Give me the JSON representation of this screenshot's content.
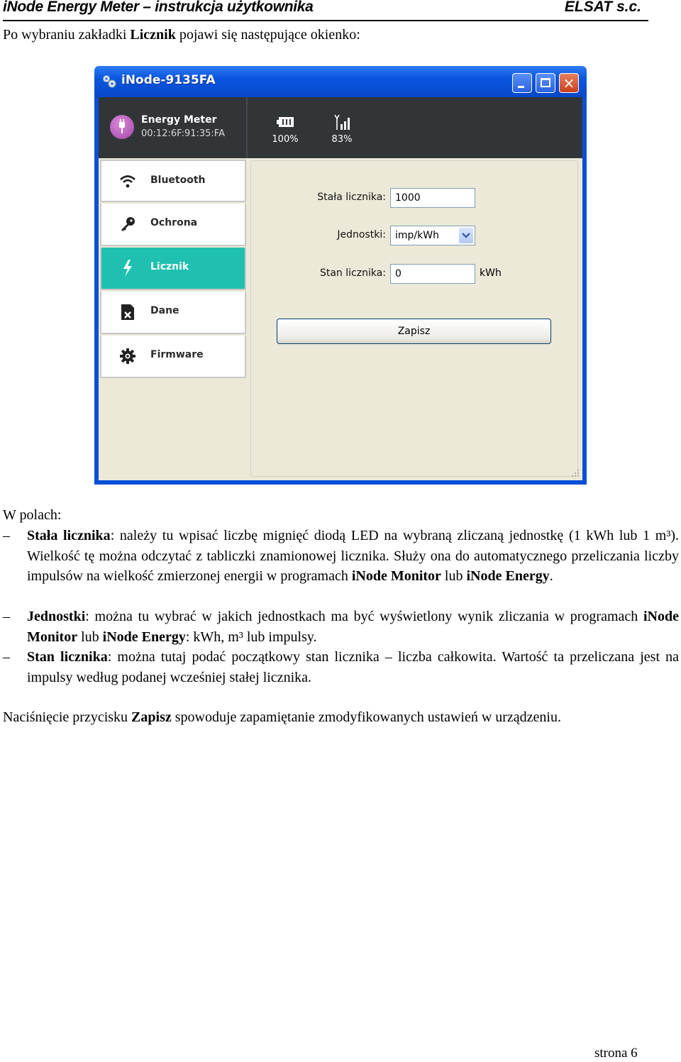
{
  "header": {
    "title": "iNode Energy Meter – instrukcja użytkownika",
    "company": "ELSAT s.c."
  },
  "intro": {
    "before": "Po wybraniu zakładki ",
    "bold": "Licznik",
    "after": " pojawi się następujące okienko:"
  },
  "window": {
    "title": "iNode-9135FA",
    "controls": {
      "minimize": "minimize",
      "maximize": "maximize",
      "close": "×"
    },
    "device": {
      "name": "Energy Meter",
      "mac": "00:12:6F:91:35:FA",
      "battery": "100%",
      "signal": "83%"
    },
    "sidebar": {
      "items": [
        {
          "label": "Bluetooth",
          "icon": "wifi-icon",
          "active": false
        },
        {
          "label": "Ochrona",
          "icon": "key-icon",
          "active": false
        },
        {
          "label": "Licznik",
          "icon": "lightning-icon",
          "active": true
        },
        {
          "label": "Dane",
          "icon": "sd-card-error-icon",
          "active": false
        },
        {
          "label": "Firmware",
          "icon": "gear-icon",
          "active": false
        }
      ]
    },
    "form": {
      "constant_label": "Stała licznika:",
      "constant_value": "1000",
      "units_label": "Jednostki:",
      "units_value": "imp/kWh",
      "state_label": "Stan licznika:",
      "state_value": "0",
      "state_unit": "kWh",
      "save_label": "Zapisz"
    },
    "colors": {
      "active_tab": "#1fc0b0",
      "topbar": "#323538",
      "device_icon": "#b555b8"
    }
  },
  "body": {
    "lead": "W polach:",
    "items": [
      {
        "term": "Stała licznika",
        "text1": ": należy tu wpisać liczbę mignięć diodą LED na wybraną zliczaną jednostkę (1 kWh lub 1 m³). Wielkość tę można odczytać z tabliczki znamionowej licznika. Służy ona do automatycznego przeliczania liczby impulsów na wielkość zmierzonej energii w programach ",
        "b1": "iNode Monitor",
        "mid": " lub ",
        "b2": "iNode Energy",
        "text2": "."
      },
      {
        "term": "Jednostki",
        "text1": ": można tu wybrać w jakich jednostkach ma być wyświetlony wynik zliczania w programach ",
        "b1": "iNode Monitor",
        "mid": " lub ",
        "b2": "iNode Energy",
        "text2": ": kWh, m³ lub impulsy."
      },
      {
        "term": "Stan licznika",
        "text1": ": można tutaj podać początkowy stan licznika – liczba całkowita. Wartość ta przeliczana jest na impulsy według podanej wcześniej stałej licznika."
      }
    ],
    "closing_before": "Naciśnięcie przycisku ",
    "closing_bold": "Zapisz",
    "closing_after": " spowoduje zapamiętanie zmodyfikowanych ustawień w urządzeniu."
  },
  "footer": {
    "page": "strona 6"
  }
}
